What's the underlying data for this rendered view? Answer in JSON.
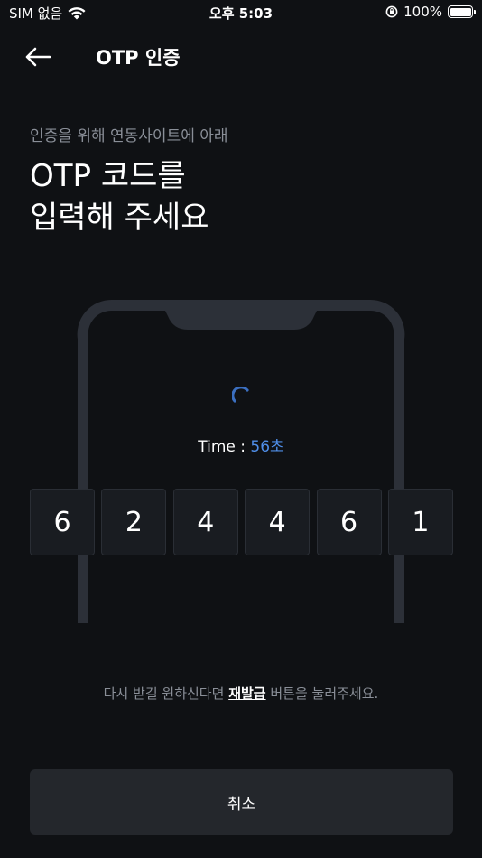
{
  "status_bar": {
    "carrier": "SIM 없음",
    "time": "오후 5:03",
    "battery": "100%"
  },
  "header": {
    "title": "OTP 인증",
    "back_icon": "arrow-left-icon"
  },
  "intro": {
    "subtitle": "인증을 위해 연동사이트에 아래",
    "headline_line1": "OTP 코드를",
    "headline_line2": "입력해 주세요"
  },
  "timer": {
    "label": "Time : ",
    "value": "56초",
    "accent_color": "#4f8ee8"
  },
  "otp_digits": [
    "6",
    "2",
    "4",
    "4",
    "6",
    "1"
  ],
  "hint": {
    "prefix": "다시 받길 원하신다면 ",
    "link": "재발급",
    "suffix": " 버튼을 눌러주세요."
  },
  "cancel_label": "취소",
  "colors": {
    "background": "#0f1114",
    "accent": "#4f8ee8",
    "button": "#24272c"
  }
}
